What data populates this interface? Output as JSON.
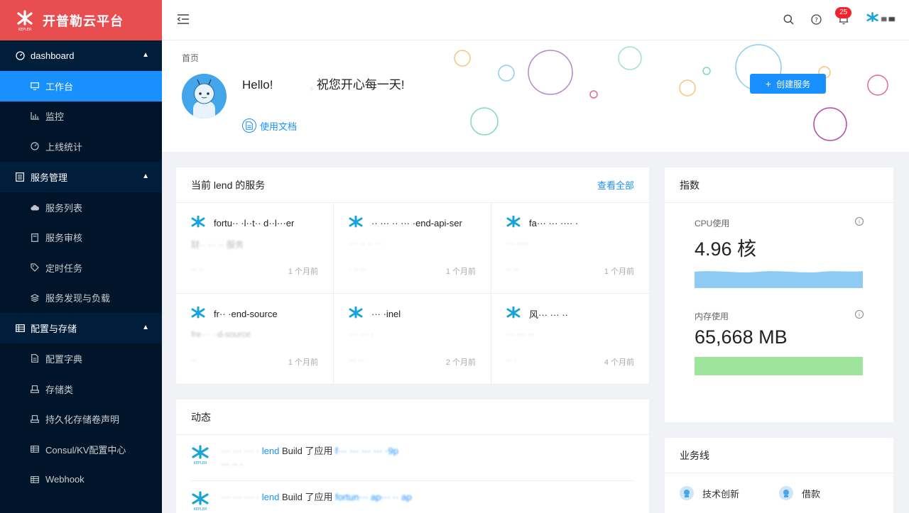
{
  "brand": {
    "title": "开普勒云平台",
    "logo_text": "KEPLER"
  },
  "sidebar": {
    "groups": [
      {
        "label": "dashboard",
        "icon": "gauge-icon",
        "items": [
          {
            "label": "工作台",
            "icon": "monitor-icon",
            "active": true
          },
          {
            "label": "监控",
            "icon": "bar-chart-icon"
          },
          {
            "label": "上线统计",
            "icon": "gauge-icon"
          }
        ]
      },
      {
        "label": "服务管理",
        "icon": "list-icon",
        "items": [
          {
            "label": "服务列表",
            "icon": "cloud-icon"
          },
          {
            "label": "服务审核",
            "icon": "audit-icon"
          },
          {
            "label": "定时任务",
            "icon": "tag-icon"
          },
          {
            "label": "服务发现与负载",
            "icon": "cluster-icon"
          }
        ]
      },
      {
        "label": "配置与存储",
        "icon": "table-icon",
        "items": [
          {
            "label": "配置字典",
            "icon": "file-icon"
          },
          {
            "label": "存储类",
            "icon": "storage-icon"
          },
          {
            "label": "持久化存储卷声明",
            "icon": "storage-icon"
          },
          {
            "label": "Consul/KV配置中心",
            "icon": "table-icon"
          },
          {
            "label": "Webhook",
            "icon": "table-icon"
          }
        ]
      }
    ]
  },
  "header": {
    "notification_count": "25"
  },
  "pagehead": {
    "breadcrumb": "首页",
    "hello_prefix": "Hello!",
    "hello_name": "           , ",
    "hello_suffix": "祝您开心每一天!",
    "doc_link": "使用文档",
    "create_button": "创建服务"
  },
  "services_card": {
    "title": "当前 lend 的服务",
    "view_all": "查看全部",
    "services": [
      {
        "name": "fortu·· ·l··t·· d··l···er",
        "desc": "财·· ··· ·· 服务",
        "owner": "·· ··",
        "time": "1 个月前"
      },
      {
        "name": "·· ··· ·· ··· ·end-api-ser",
        "desc": "··· ·· ·· ··",
        "owner": "· ·· ··",
        "time": "1 个月前"
      },
      {
        "name": "fa··· ··· ···· ·",
        "desc": "··· ····",
        "owner": "·· ··",
        "time": "1 个月前"
      },
      {
        "name": "fr·· ·end-source",
        "desc": "fre··· ··d-source",
        "owner": "··",
        "time": "1 个月前"
      },
      {
        "name": "··· ·inel",
        "desc": "··· ··· ·",
        "owner": "··· ··",
        "time": "2 个月前"
      },
      {
        "name": "风··· ··· ··",
        "desc": "··· ··· ··",
        "owner": "·· ·",
        "time": "4 个月前"
      }
    ]
  },
  "activity_card": {
    "title": "动态",
    "items": [
      {
        "actor": "··· ··· ··· ·",
        "project": "lend",
        "verb": "Build 了应用",
        "target": "f··· ··· ··· ··· ·9p",
        "sub": "··· ·· ·"
      },
      {
        "actor": "··· ··· ··· ·",
        "project": "lend",
        "verb": "Build 了应用",
        "target": "fortun··· ap··· ·· ap",
        "sub": ""
      }
    ]
  },
  "metrics_card": {
    "title": "指数",
    "cpu": {
      "label": "CPU使用",
      "value": "4.96 核",
      "color": "#8dcaf4"
    },
    "memory": {
      "label": "内存使用",
      "value": "65,668 MB",
      "color": "#9de59a"
    }
  },
  "biz_card": {
    "title": "业务线",
    "items": [
      {
        "label": "技术创新"
      },
      {
        "label": "借款"
      }
    ]
  }
}
